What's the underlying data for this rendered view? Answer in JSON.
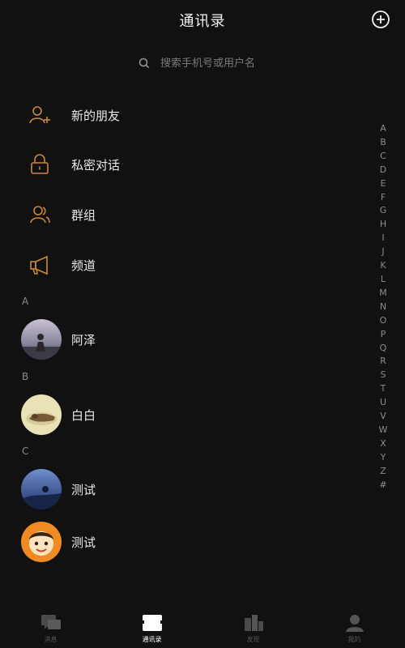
{
  "header": {
    "title": "通讯录",
    "add_icon": "plus-circle-icon"
  },
  "search": {
    "placeholder": "搜索手机号或用户名"
  },
  "menu": [
    {
      "label": "新的朋友",
      "icon": "add-friend-icon"
    },
    {
      "label": "私密对话",
      "icon": "lock-icon"
    },
    {
      "label": "群组",
      "icon": "group-icon"
    },
    {
      "label": "频道",
      "icon": "megaphone-icon"
    }
  ],
  "sections": [
    {
      "letter": "A",
      "contacts": [
        {
          "name": "阿泽"
        }
      ]
    },
    {
      "letter": "B",
      "contacts": [
        {
          "name": "白白"
        }
      ]
    },
    {
      "letter": "C",
      "contacts": [
        {
          "name": "测试"
        },
        {
          "name": "测试"
        }
      ]
    }
  ],
  "alphabet": [
    "A",
    "B",
    "C",
    "D",
    "E",
    "F",
    "G",
    "H",
    "I",
    "J",
    "K",
    "L",
    "M",
    "N",
    "O",
    "P",
    "Q",
    "R",
    "S",
    "T",
    "U",
    "V",
    "W",
    "X",
    "Y",
    "Z",
    "#"
  ],
  "tabs": [
    {
      "label": "消息",
      "icon": "chat-icon",
      "active": false
    },
    {
      "label": "通讯录",
      "icon": "contacts-icon",
      "active": true
    },
    {
      "label": "发现",
      "icon": "discover-icon",
      "active": false
    },
    {
      "label": "我的",
      "icon": "profile-icon",
      "active": false
    }
  ],
  "colors": {
    "background": "#111111",
    "accent": "#c8893a",
    "text": "#e8e8e8",
    "muted": "#8c8c8c"
  }
}
